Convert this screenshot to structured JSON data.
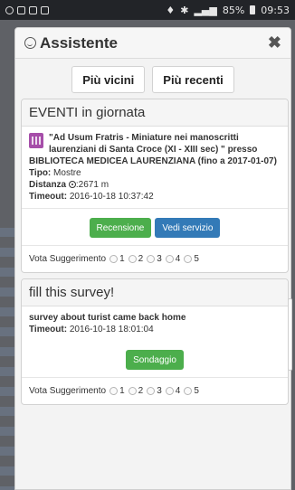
{
  "status_bar": {
    "battery": "85%",
    "time": "09:53"
  },
  "modal": {
    "title": "Assistente",
    "close_icon": "close-icon",
    "tabs": [
      {
        "label": "Più vicini"
      },
      {
        "label": "Più recenti"
      }
    ]
  },
  "cards": [
    {
      "title": "EVENTI in giornata",
      "event_name": "\"Ad Usum Fratris - Miniature nei manoscritti laurenziani di Santa Croce (XI - XIII sec) \" presso",
      "event_place": "BIBLIOTECA MEDICEA LAURENZIANA (fino a 2017-01-07)",
      "tipo_label": "Tipo:",
      "tipo_value": "Mostre",
      "distanza_label": "Distanza",
      "distanza_value": ":2671 m",
      "timeout_label": "Timeout:",
      "timeout_value": "2016-10-18 10:37:42",
      "buttons": [
        {
          "label": "Recensione",
          "color": "#4cae4c"
        },
        {
          "label": "Vedi servizio",
          "color": "#337ab7"
        }
      ],
      "vote_label": "Vota Suggerimento",
      "vote_options": [
        "1",
        "2",
        "3",
        "4",
        "5"
      ]
    },
    {
      "title": "fill this survey!",
      "description": "survey about turist came back home",
      "timeout_label": "Timeout:",
      "timeout_value": "2016-10-18 18:01:04",
      "buttons": [
        {
          "label": "Sondaggio",
          "color": "#4cae4c"
        }
      ],
      "vote_label": "Vota Suggerimento",
      "vote_options": [
        "1",
        "2",
        "3",
        "4",
        "5"
      ]
    }
  ]
}
